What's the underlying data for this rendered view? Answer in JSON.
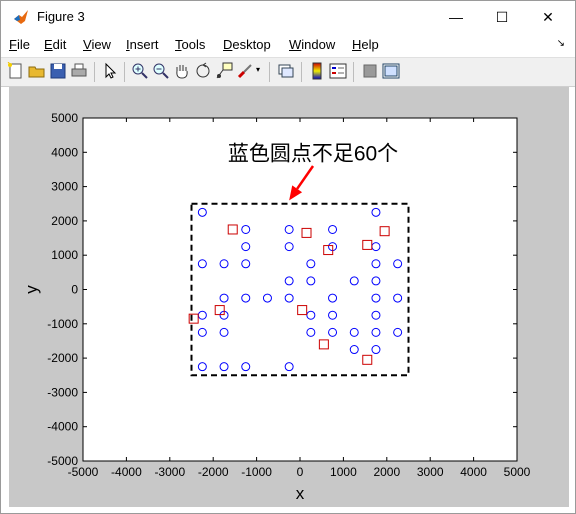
{
  "window": {
    "title": "Figure 3",
    "minimize": "—",
    "maximize": "☐",
    "close": "✕"
  },
  "menu": {
    "items": [
      {
        "label": "File",
        "mnemonic": "F"
      },
      {
        "label": "Edit",
        "mnemonic": "E"
      },
      {
        "label": "View",
        "mnemonic": "V"
      },
      {
        "label": "Insert",
        "mnemonic": "I"
      },
      {
        "label": "Tools",
        "mnemonic": "T"
      },
      {
        "label": "Desktop",
        "mnemonic": "D"
      },
      {
        "label": "Window",
        "mnemonic": "W"
      },
      {
        "label": "Help",
        "mnemonic": "H"
      }
    ]
  },
  "toolbar": {
    "icons": [
      "new-figure-icon",
      "open-file-icon",
      "save-icon",
      "print-icon",
      "pointer-icon",
      "zoom-in-icon",
      "zoom-out-icon",
      "pan-icon",
      "rotate-3d-icon",
      "data-cursor-icon",
      "brush-icon",
      "link-plot-icon",
      "colorbar-icon",
      "legend-icon",
      "hide-plot-tools-icon",
      "show-plot-tools-icon"
    ]
  },
  "colors": {
    "figure_bg": "#c8c8c8",
    "axes_bg": "#ffffff",
    "blue_marker": "#0000ff",
    "red_marker": "#cc0000",
    "annotation_arrow": "#ff0000"
  },
  "chart_data": {
    "type": "scatter",
    "xlabel": "x",
    "ylabel": "y",
    "xlim": [
      -5000,
      5000
    ],
    "ylim": [
      -5000,
      5000
    ],
    "xticks": [
      -5000,
      -4000,
      -3000,
      -2000,
      -1000,
      0,
      1000,
      2000,
      3000,
      4000,
      5000
    ],
    "yticks": [
      -5000,
      -4000,
      -3000,
      -2000,
      -1000,
      0,
      1000,
      2000,
      3000,
      4000,
      5000
    ],
    "annotation": "蓝色圆点不足60个",
    "annotation_arrow_tip": [
      -250,
      2600
    ],
    "annotation_arrow_tail": [
      300,
      3600
    ],
    "rectangle": {
      "x0": -2500,
      "x1": 2500,
      "y0": -2500,
      "y1": 2500,
      "style": "dashed"
    },
    "series": [
      {
        "marker": "circle",
        "color": "#0000ff",
        "points": [
          [
            -2250,
            2250
          ],
          [
            -2250,
            750
          ],
          [
            -2250,
            -750
          ],
          [
            -2250,
            -1250
          ],
          [
            -2250,
            -2250
          ],
          [
            -1750,
            750
          ],
          [
            -1750,
            -250
          ],
          [
            -1750,
            -750
          ],
          [
            -1750,
            -1250
          ],
          [
            -1750,
            -2250
          ],
          [
            -1250,
            1750
          ],
          [
            -1250,
            1250
          ],
          [
            -1250,
            750
          ],
          [
            -1250,
            -250
          ],
          [
            -1250,
            -2250
          ],
          [
            -750,
            -250
          ],
          [
            -250,
            1750
          ],
          [
            -250,
            1250
          ],
          [
            -250,
            250
          ],
          [
            -250,
            -250
          ],
          [
            -250,
            -2250
          ],
          [
            250,
            750
          ],
          [
            250,
            250
          ],
          [
            250,
            -750
          ],
          [
            250,
            -1250
          ],
          [
            750,
            1750
          ],
          [
            750,
            1250
          ],
          [
            750,
            -250
          ],
          [
            750,
            -750
          ],
          [
            750,
            -1250
          ],
          [
            1250,
            250
          ],
          [
            1250,
            -1250
          ],
          [
            1250,
            -1750
          ],
          [
            1750,
            2250
          ],
          [
            1750,
            1250
          ],
          [
            1750,
            750
          ],
          [
            1750,
            250
          ],
          [
            1750,
            -250
          ],
          [
            1750,
            -750
          ],
          [
            1750,
            -1250
          ],
          [
            1750,
            -1750
          ],
          [
            2250,
            750
          ],
          [
            2250,
            -250
          ],
          [
            2250,
            -1250
          ]
        ]
      },
      {
        "marker": "square",
        "color": "#cc0000",
        "points": [
          [
            -1550,
            1750
          ],
          [
            150,
            1650
          ],
          [
            650,
            1150
          ],
          [
            1550,
            1300
          ],
          [
            1950,
            1700
          ],
          [
            -1850,
            -600
          ],
          [
            -2450,
            -850
          ],
          [
            50,
            -600
          ],
          [
            550,
            -1600
          ],
          [
            1550,
            -2050
          ]
        ]
      }
    ]
  }
}
